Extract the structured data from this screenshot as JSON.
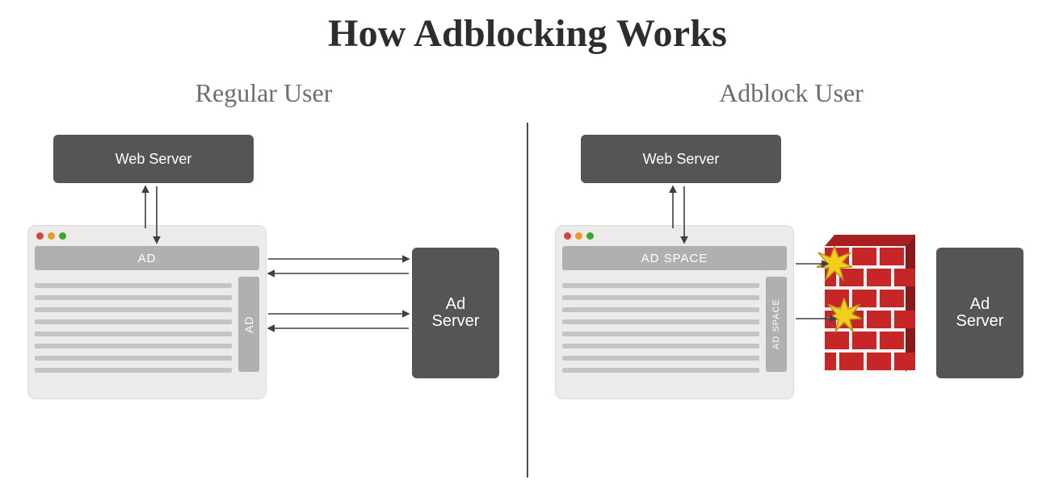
{
  "title": "How Adblocking Works",
  "left": {
    "heading": "Regular User",
    "webserver": "Web Server",
    "adserver": "Ad Server",
    "ad_banner": "AD",
    "ad_side": "AD"
  },
  "right": {
    "heading": "Adblock User",
    "webserver": "Web Server",
    "adserver": "Ad Server",
    "ad_banner": "AD SPACE",
    "ad_side": "AD SPACE"
  },
  "colors": {
    "server_bg": "#555555",
    "browser_bg": "#eceaea",
    "ad_fill": "#b0b0b0",
    "brick": "#c62626",
    "brick_mortar": "#f2f2f2",
    "star_fill": "#f2cf1d",
    "star_stroke": "#b8891c",
    "arrow": "#3f3f3f"
  }
}
